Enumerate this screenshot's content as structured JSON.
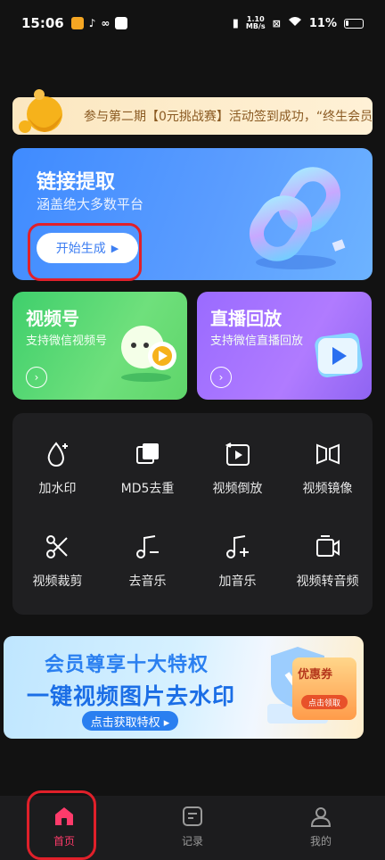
{
  "status_bar": {
    "time": "15:06",
    "net_speed_top": "1.10",
    "net_speed_bottom": "MB/s",
    "battery": "11%"
  },
  "notice": {
    "text": "参与第二期【0元挑战赛】活动签到成功，“终生会员"
  },
  "link_card": {
    "title": "链接提取",
    "subtitle": "涵盖绝大多数平台",
    "button_label": "开始生成"
  },
  "video_card": {
    "title": "视频号",
    "subtitle": "支持微信视频号"
  },
  "live_card": {
    "title": "直播回放",
    "subtitle": "支持微信直播回放"
  },
  "tools": [
    {
      "label": "加水印",
      "icon": "watermark-drop-icon"
    },
    {
      "label": "MD5去重",
      "icon": "md5-squares-icon"
    },
    {
      "label": "视频倒放",
      "icon": "video-reverse-icon"
    },
    {
      "label": "视频镜像",
      "icon": "video-mirror-icon"
    },
    {
      "label": "视频裁剪",
      "icon": "scissors-icon"
    },
    {
      "label": "去音乐",
      "icon": "music-minus-icon"
    },
    {
      "label": "加音乐",
      "icon": "music-plus-icon"
    },
    {
      "label": "视频转音频",
      "icon": "video-to-audio-icon"
    }
  ],
  "banner": {
    "line1": "会员尊享十大特权",
    "line2": "一键视频图片去水印",
    "cta": "点击获取特权 ▸",
    "coupon_title": "优惠券",
    "coupon_button": "点击领取"
  },
  "tabbar": {
    "items": [
      {
        "label": "首页",
        "active": true
      },
      {
        "label": "记录",
        "active": false
      },
      {
        "label": "我的",
        "active": false
      }
    ]
  },
  "colors": {
    "accent_red": "#e0202a",
    "tab_active": "#ff3b6b",
    "link_card_blue": "#3f8bff",
    "video_card_green": "#3fcf6c",
    "live_card_purple": "#9a6bff"
  }
}
